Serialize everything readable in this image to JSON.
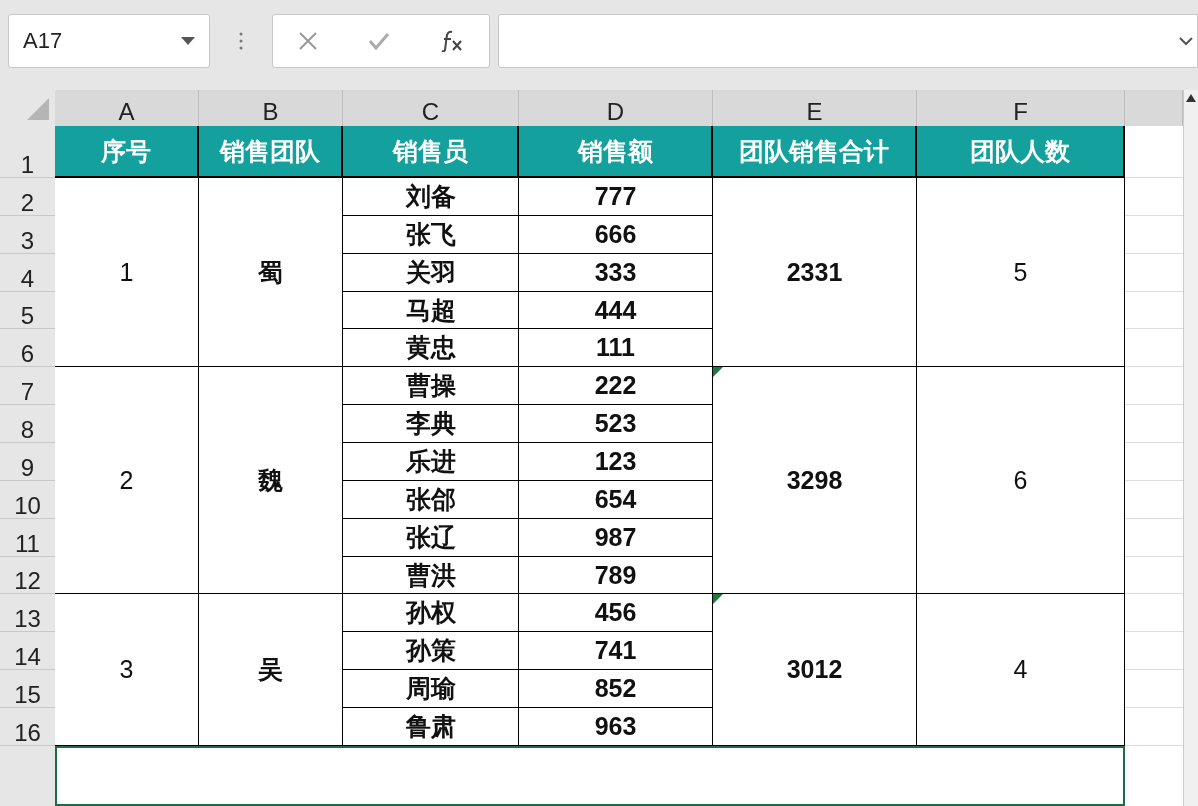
{
  "name_box": {
    "value": "A17"
  },
  "columns": [
    "A",
    "B",
    "C",
    "D",
    "E",
    "F"
  ],
  "row_numbers": [
    "1",
    "2",
    "3",
    "4",
    "5",
    "6",
    "7",
    "8",
    "9",
    "10",
    "11",
    "12",
    "13",
    "14",
    "15",
    "16"
  ],
  "headers": [
    "序号",
    "销售团队",
    "销售员",
    "销售额",
    "团队销售合计",
    "团队人数"
  ],
  "groups": [
    {
      "seq": "1",
      "team": "蜀",
      "total": "2331",
      "count": "5",
      "error_flag": false,
      "members": [
        {
          "name": "刘备",
          "amount": "777"
        },
        {
          "name": "张飞",
          "amount": "666"
        },
        {
          "name": "关羽",
          "amount": "333"
        },
        {
          "name": "马超",
          "amount": "444"
        },
        {
          "name": "黄忠",
          "amount": "111"
        }
      ]
    },
    {
      "seq": "2",
      "team": "魏",
      "total": "3298",
      "count": "6",
      "error_flag": true,
      "members": [
        {
          "name": "曹操",
          "amount": "222"
        },
        {
          "name": "李典",
          "amount": "523"
        },
        {
          "name": "乐进",
          "amount": "123"
        },
        {
          "name": "张郃",
          "amount": "654"
        },
        {
          "name": "张辽",
          "amount": "987"
        },
        {
          "name": "曹洪",
          "amount": "789"
        }
      ]
    },
    {
      "seq": "3",
      "team": "吴",
      "total": "3012",
      "count": "4",
      "error_flag": true,
      "members": [
        {
          "name": "孙权",
          "amount": "456"
        },
        {
          "name": "孙策",
          "amount": "741"
        },
        {
          "name": "周瑜",
          "amount": "852"
        },
        {
          "name": "鲁肃",
          "amount": "963"
        }
      ]
    }
  ],
  "selected_cell": {
    "selected": true
  }
}
